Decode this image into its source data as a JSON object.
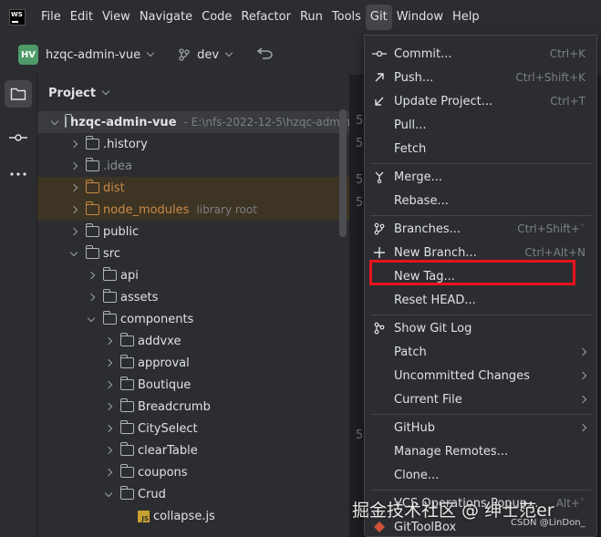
{
  "app": {
    "logo_text": "WS"
  },
  "menubar": {
    "items": [
      "File",
      "Edit",
      "View",
      "Navigate",
      "Code",
      "Refactor",
      "Run",
      "Tools",
      "Git",
      "Window",
      "Help"
    ],
    "active": "Git"
  },
  "toolbar": {
    "project_badge": "HV",
    "project_name": "hzqc-admin-vue",
    "branch": "dev"
  },
  "panel": {
    "title": "Project",
    "tree": [
      {
        "label": "hzqc-admin-vue",
        "hint": "- E:\\nfs-2022-12-5\\hzqc-admin",
        "indent": 0,
        "expanded": true,
        "bold": true,
        "selected": true,
        "type": "folder"
      },
      {
        "label": ".history",
        "indent": 1,
        "type": "folder"
      },
      {
        "label": ".idea",
        "indent": 1,
        "type": "folder",
        "dim": true
      },
      {
        "label": "dist",
        "indent": 1,
        "type": "folder",
        "excluded": true
      },
      {
        "label": "node_modules",
        "hint": "library root",
        "indent": 1,
        "type": "folder",
        "excluded": true
      },
      {
        "label": "public",
        "indent": 1,
        "type": "folder"
      },
      {
        "label": "src",
        "indent": 1,
        "expanded": true,
        "type": "folder"
      },
      {
        "label": "api",
        "indent": 2,
        "type": "folder"
      },
      {
        "label": "assets",
        "indent": 2,
        "type": "folder"
      },
      {
        "label": "components",
        "indent": 2,
        "expanded": true,
        "type": "folder"
      },
      {
        "label": "addvxe",
        "indent": 3,
        "type": "folder"
      },
      {
        "label": "approval",
        "indent": 3,
        "type": "folder"
      },
      {
        "label": "Boutique",
        "indent": 3,
        "type": "folder"
      },
      {
        "label": "Breadcrumb",
        "indent": 3,
        "type": "folder"
      },
      {
        "label": "CitySelect",
        "indent": 3,
        "type": "folder"
      },
      {
        "label": "clearTable",
        "indent": 3,
        "type": "folder"
      },
      {
        "label": "coupons",
        "indent": 3,
        "type": "folder"
      },
      {
        "label": "Crud",
        "indent": 3,
        "expanded": true,
        "type": "folder"
      },
      {
        "label": "collapse.js",
        "indent": 4,
        "type": "js"
      }
    ]
  },
  "git_menu": {
    "items": [
      {
        "label": "Commit...",
        "shortcut": "Ctrl+K",
        "icon": "commit-icon"
      },
      {
        "label": "Push...",
        "shortcut": "Ctrl+Shift+K",
        "icon": "push-icon"
      },
      {
        "label": "Update Project...",
        "shortcut": "Ctrl+T",
        "icon": "update-icon"
      },
      {
        "label": "Pull...",
        "shortcut": "",
        "icon": ""
      },
      {
        "label": "Fetch",
        "shortcut": "",
        "icon": ""
      },
      {
        "sep": true
      },
      {
        "label": "Merge...",
        "shortcut": "",
        "icon": "merge-icon"
      },
      {
        "label": "Rebase...",
        "shortcut": "",
        "icon": ""
      },
      {
        "sep": true
      },
      {
        "label": "Branches...",
        "shortcut": "Ctrl+Shift+`",
        "icon": "branch-icon"
      },
      {
        "label": "New Branch...",
        "shortcut": "Ctrl+Alt+N",
        "icon": "plus-icon"
      },
      {
        "label": "New Tag...",
        "shortcut": "",
        "icon": "",
        "highlighted": true
      },
      {
        "label": "Reset HEAD...",
        "shortcut": "",
        "icon": ""
      },
      {
        "sep": true
      },
      {
        "label": "Show Git Log",
        "shortcut": "",
        "icon": "git-log-icon"
      },
      {
        "label": "Patch",
        "submenu": true
      },
      {
        "label": "Uncommitted Changes",
        "submenu": true
      },
      {
        "label": "Current File",
        "submenu": true
      },
      {
        "sep": true
      },
      {
        "label": "GitHub",
        "submenu": true
      },
      {
        "label": "Manage Remotes..."
      },
      {
        "label": "Clone..."
      },
      {
        "sep": true
      },
      {
        "label": "VCS Operations Popup...",
        "shortcut": "Alt+`"
      },
      {
        "label": "GitToolBox",
        "icon": "gittoolbox-icon"
      }
    ]
  },
  "gutter": [
    "5",
    "5",
    "5",
    "5",
    "5"
  ],
  "watermark": {
    "main": "掘金技术社区 @ 绅士范er",
    "sub": "CSDN @LinDon_"
  },
  "colors": {
    "highlight": "#e8141b",
    "project_badge": "#4e9a68",
    "excluded": "#c98a45"
  }
}
